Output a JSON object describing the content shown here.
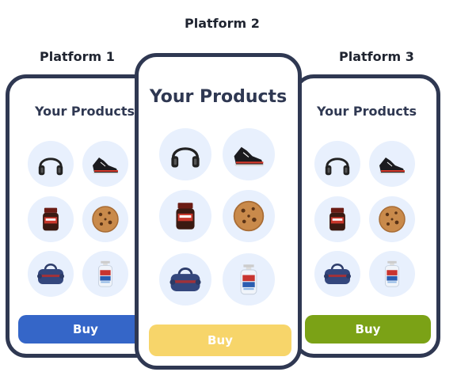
{
  "labels": {
    "platform1": "Platform 1",
    "platform2": "Platform 2",
    "platform3": "Platform 3"
  },
  "screens": [
    {
      "title": "Your Products",
      "buy_label": "Buy",
      "buy_color": "#3566c8"
    },
    {
      "title": "Your Products",
      "buy_label": "Buy",
      "buy_color": "#f7d56a"
    },
    {
      "title": "Your Products",
      "buy_label": "Buy",
      "buy_color": "#7ba216"
    }
  ],
  "products": [
    "headphones-icon",
    "sneaker-icon",
    "coffee-jar-icon",
    "cookie-icon",
    "duffel-bag-icon",
    "sanitizer-bottle-icon"
  ],
  "colors": {
    "frame": "#2f3852",
    "circle_bg": "#e8f0fd"
  }
}
